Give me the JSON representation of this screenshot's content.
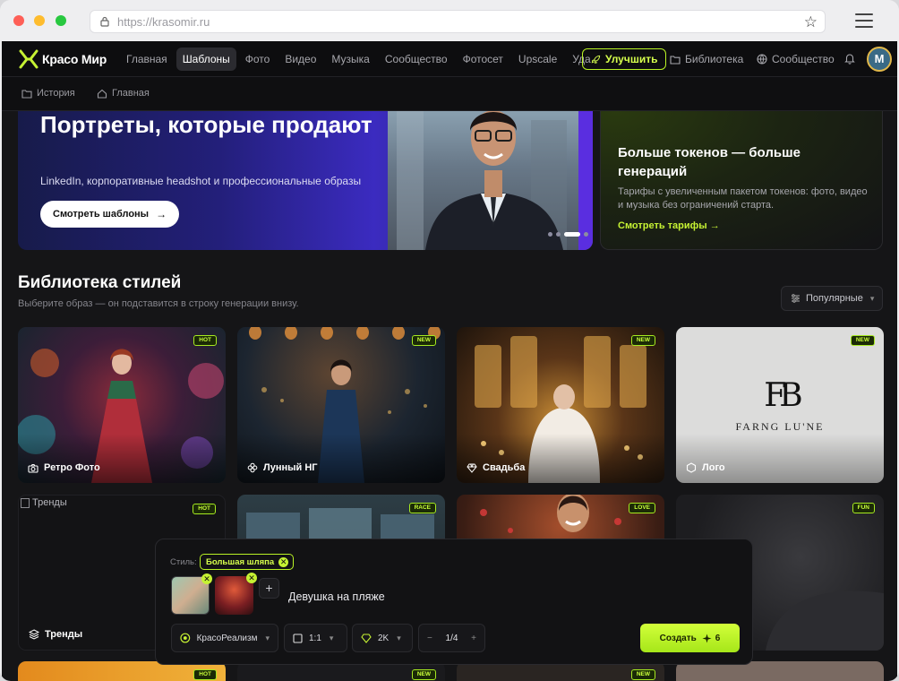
{
  "browser": {
    "url": "https://krasomir.ru"
  },
  "nav": {
    "logo_text": "Красо Мир",
    "links": [
      "Главная",
      "Шаблоны",
      "Фото",
      "Видео",
      "Музыка",
      "Сообщество",
      "Фотосет",
      "Upscale",
      "Уда"
    ],
    "active_link": "Шаблоны",
    "upgrade_label": "Улучшить",
    "library_label": "Библиотека",
    "community_label": "Сообщество",
    "avatar_initial": "M"
  },
  "subnav": {
    "history_label": "История",
    "home_label": "Главная"
  },
  "hero": {
    "title": "Портреты, которые продают",
    "subtitle": "LinkedIn, корпоративные headshot и профессиональные образы",
    "button_label": "Смотреть шаблоны",
    "slide_count": 4,
    "active_slide": 3
  },
  "promo": {
    "title": "Больше токенов — больше генераций",
    "subtitle": "Тарифы с увеличенным пакетом токенов: фото, видео и музыка без ограничений старта.",
    "link_label": "Смотреть тарифы"
  },
  "styles": {
    "title": "Библиотека стилей",
    "subtitle": "Выберите образ — он подставится в строку генерации внизу.",
    "sort_label": "Популярные",
    "cards": [
      {
        "label": "Ретро Фото",
        "badge": "HOT",
        "icon": "camera-icon"
      },
      {
        "label": "Лунный НГ",
        "badge": "NEW",
        "icon": "flower-icon"
      },
      {
        "label": "Свадьба",
        "badge": "NEW",
        "icon": "diamond-icon"
      },
      {
        "label": "Лого",
        "badge": "NEW",
        "icon": "hexagon-icon"
      },
      {
        "label": "Тренды",
        "badge": "HOT",
        "icon": "layers-icon",
        "broken_alt": "Тренды"
      },
      {
        "label": "",
        "badge": "RACE",
        "icon": ""
      },
      {
        "label": "",
        "badge": "LOVE",
        "icon": ""
      },
      {
        "label": "",
        "badge": "FUN",
        "icon": ""
      },
      {
        "label": "",
        "badge": "HOT",
        "icon": ""
      },
      {
        "label": "",
        "badge": "NEW",
        "icon": ""
      },
      {
        "label": "",
        "badge": "NEW",
        "icon": ""
      }
    ],
    "logo_card": {
      "monogram": "FB",
      "wordmark": "FARNG LU'NE"
    }
  },
  "generator": {
    "style_label": "Стиль:",
    "style_chip": "Большая шляпа",
    "prompt": "Девушка на пляже",
    "model": "КрасоРеализм",
    "ratio": "1:1",
    "resolution": "2K",
    "count_display": "1/4",
    "create_label": "Создать",
    "create_cost": "6"
  },
  "colors": {
    "accent": "#c6f233",
    "background": "#151517",
    "hero_gradient_end": "#3b2bc0"
  }
}
